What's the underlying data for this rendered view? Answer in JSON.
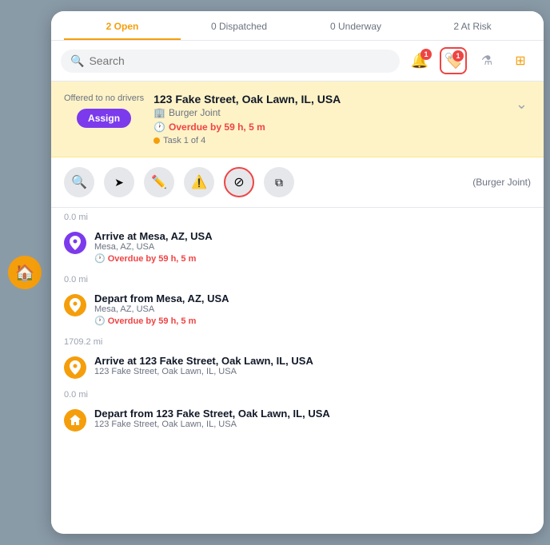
{
  "tabs": [
    {
      "label": "2 Open",
      "active": true
    },
    {
      "label": "0 Dispatched",
      "active": false
    },
    {
      "label": "0 Underway",
      "active": false
    },
    {
      "label": "2 At Risk",
      "active": false
    }
  ],
  "search": {
    "placeholder": "Search"
  },
  "icons": {
    "bell_label": "bell-icon",
    "bell_badge": "1",
    "tag_label": "tag-icon",
    "tag_badge": "1",
    "filter_label": "filter-icon",
    "grid_label": "grid-icon"
  },
  "order": {
    "offered_text": "Offered to no drivers",
    "assign_label": "Assign",
    "address": "123 Fake Street, Oak Lawn, IL, USA",
    "business": "Burger Joint",
    "overdue": "Overdue by 59 h, 5 m",
    "task_label": "Task 1 of 4"
  },
  "actions": {
    "search_icon": "🔍",
    "send_icon": "➤",
    "edit_icon": "✏️",
    "warning_icon": "⚠️",
    "cancel_icon": "🚫",
    "copy_icon": "⧉",
    "company": "(Burger Joint)"
  },
  "task_items": [
    {
      "distance": "0.0 mi",
      "icon_type": "purple",
      "icon": "📍",
      "title": "Arrive at Mesa, AZ, USA",
      "address": "Mesa, AZ, USA",
      "overdue": "Overdue by 59 h, 5 m",
      "show_overdue": true
    },
    {
      "distance": "0.0 mi",
      "icon_type": "orange",
      "icon": "📍",
      "title": "Depart from Mesa, AZ, USA",
      "address": "Mesa, AZ, USA",
      "overdue": "Overdue by 59 h, 5 m",
      "show_overdue": true
    },
    {
      "distance": "1709.2 mi",
      "icon_type": "orange",
      "icon": "📍",
      "title": "Arrive at 123 Fake Street, Oak Lawn, IL, USA",
      "address": "123 Fake Street, Oak Lawn, IL, USA",
      "overdue": "",
      "show_overdue": false
    },
    {
      "distance": "0.0 mi",
      "icon_type": "home",
      "icon": "🏠",
      "title": "Depart from 123 Fake Street, Oak Lawn, IL, USA",
      "address": "123 Fake Street, Oak Lawn, IL, USA",
      "overdue": "",
      "show_overdue": false
    }
  ]
}
